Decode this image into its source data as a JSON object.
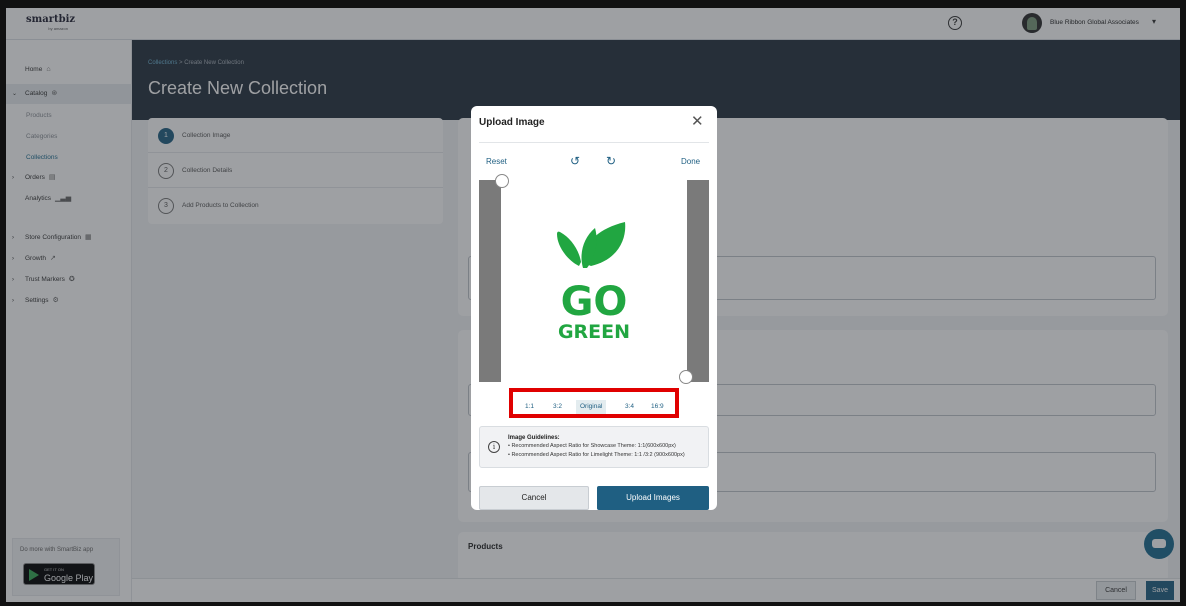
{
  "app": {
    "logo_main": "smartbiz",
    "logo_sub": "by amazon",
    "help_icon": "question-circle-icon",
    "account_name": "Blue Ribbon Global Associates"
  },
  "sidebar": {
    "home": "Home",
    "catalog": "Catalog",
    "catalog_sub": [
      "Products",
      "Categories",
      "Collections"
    ],
    "orders": "Orders",
    "analytics": "Analytics",
    "store_configuration": "Store Configuration",
    "growth": "Growth",
    "trust_markers": "Trust Markers",
    "settings": "Settings",
    "promo_text": "Do more with SmartBiz app",
    "gplay_top": "GET IT ON",
    "gplay_main": "Google Play"
  },
  "header": {
    "breadcrumb_link": "Collections",
    "breadcrumb_sep": ">",
    "breadcrumb_current": "Create New Collection",
    "title": "Create New Collection"
  },
  "steps": [
    {
      "num": "1",
      "label": "Collection Image"
    },
    {
      "num": "2",
      "label": "Collection Details"
    },
    {
      "num": "3",
      "label": "Add Products to Collection"
    }
  ],
  "main": {
    "products_label": "Products",
    "cancel_label": "Cancel",
    "save_label": "Save"
  },
  "modal": {
    "title": "Upload Image",
    "reset_label": "Reset",
    "done_label": "Done",
    "image_text_line1": "GO",
    "image_text_line2": "GREEN",
    "image_color": "#21a641",
    "ratios": [
      "1:1",
      "3:2",
      "Original",
      "3:4",
      "16:9"
    ],
    "selected_ratio": "Original",
    "guidelines_title": "Image Guidelines:",
    "guidelines": [
      "• Recommended Aspect Ratio for Showcase Theme: 1:1(600x600px)",
      "• Recommended Aspect Ratio for Limelight Theme: 1:1 /3:2 (900x600px)"
    ],
    "cancel_label": "Cancel",
    "upload_label": "Upload Images"
  },
  "colors": {
    "primary": "#1f5f82",
    "header_bg": "#26323e",
    "highlight": "#e00000"
  }
}
